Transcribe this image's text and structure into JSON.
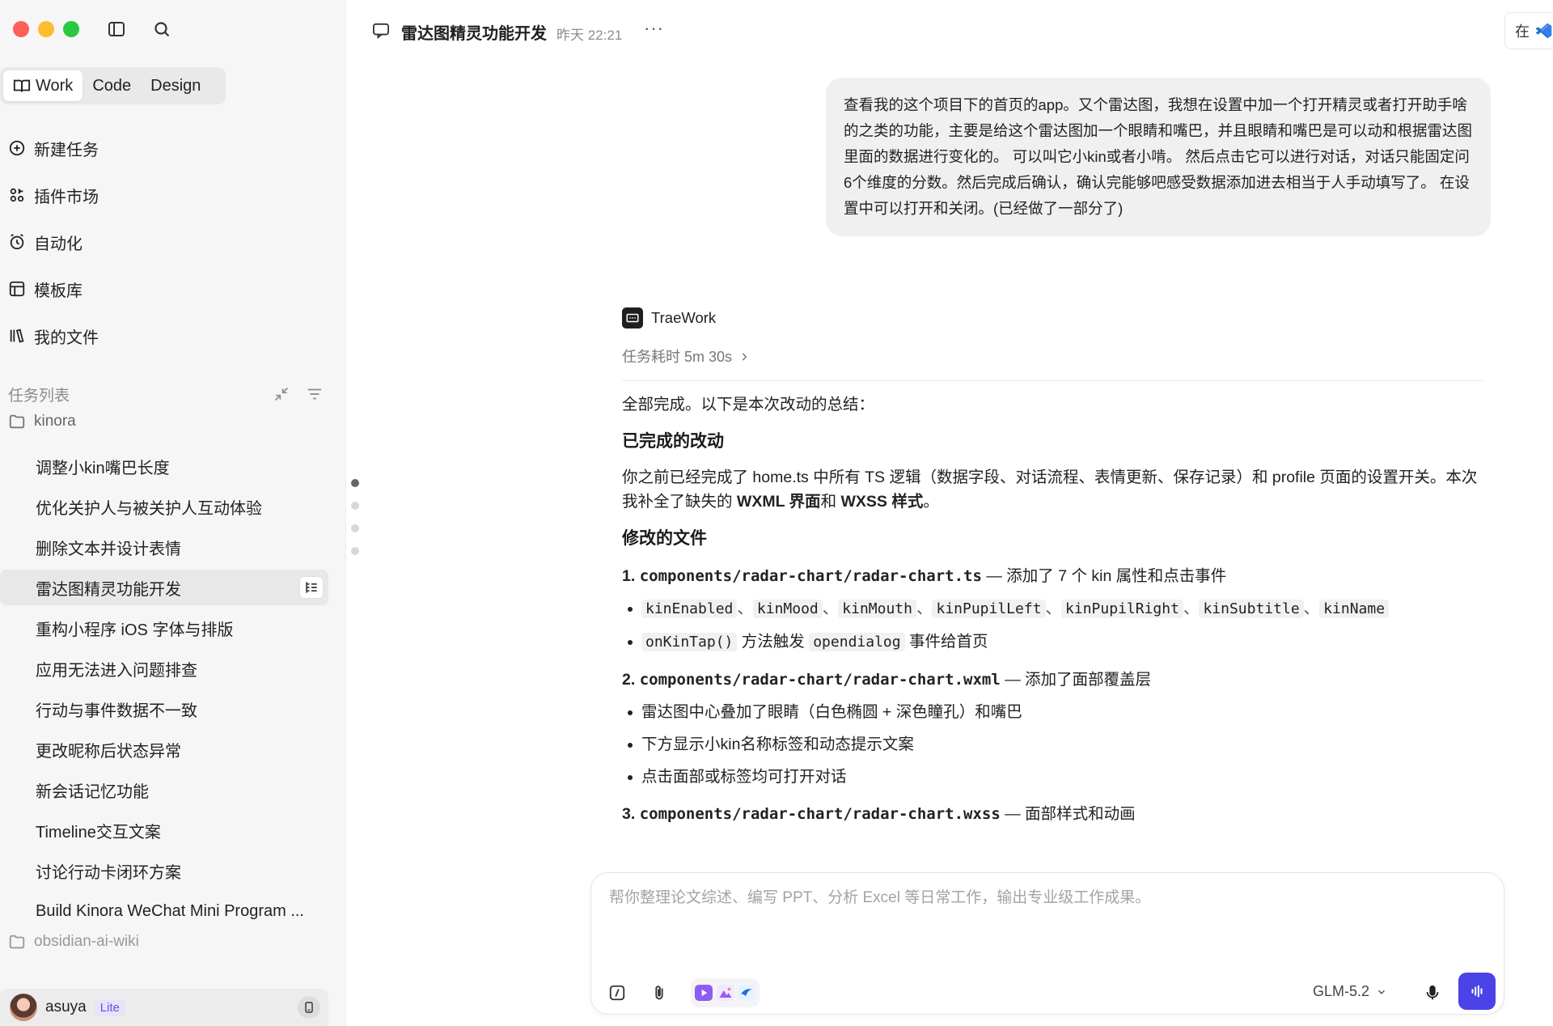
{
  "sidebar": {
    "modes": [
      {
        "label": "Work",
        "active": true
      },
      {
        "label": "Code",
        "active": false
      },
      {
        "label": "Design",
        "active": false
      }
    ],
    "nav": [
      {
        "label": "新建任务",
        "icon": "plus-circle-icon"
      },
      {
        "label": "插件市场",
        "icon": "plugins-icon"
      },
      {
        "label": "自动化",
        "icon": "alarm-clock-icon"
      },
      {
        "label": "模板库",
        "icon": "template-icon"
      },
      {
        "label": "我的文件",
        "icon": "library-icon"
      }
    ],
    "section_title": "任务列表",
    "folders": [
      "kinora",
      "obsidian-ai-wiki"
    ],
    "tasks": [
      "调整小kin嘴巴长度",
      "优化关护人与被关护人互动体验",
      "删除文本并设计表情",
      "雷达图精灵功能开发",
      "重构小程序 iOS 字体与排版",
      "应用无法进入问题排查",
      "行动与事件数据不一致",
      "更改昵称后状态异常",
      "新会话记忆功能",
      "Timeline交互文案",
      "讨论行动卡闭环方案",
      "Build Kinora WeChat Mini Program ..."
    ],
    "active_task_index": 3,
    "user": {
      "name": "asuya",
      "plan": "Lite"
    }
  },
  "header": {
    "title": "雷达图精灵功能开发",
    "time": "昨天 22:21",
    "more": "···",
    "right_chip": "在"
  },
  "user_message": "查看我的这个项目下的首页的app。又个雷达图，我想在设置中加一个打开精灵或者打开助手啥的之类的功能，主要是给这个雷达图加一个眼睛和嘴巴，并且眼睛和嘴巴是可以动和根据雷达图里面的数据进行变化的。 可以叫它小kin或者小啃。 然后点击它可以进行对话，对话只能固定问6个维度的分数。然后完成后确认，确认完能够吧感受数据添加进去相当于人手动填写了。 在设置中可以打开和关闭。(已经做了一部分了)",
  "reply": {
    "agent": "TraeWork",
    "duration": "任务耗时 5m 30s",
    "intro": "全部完成。以下是本次改动的总结：",
    "h_done": "已完成的改动",
    "done_part1": "你之前已经完成了 home.ts 中所有 TS 逻辑（数据字段、对话流程、表情更新、保存记录）和 profile 页面的设置开关。本次我补全了缺失的 ",
    "done_bold": "WXML 界面",
    "done_mid": "和 ",
    "done_bold2": "WXSS 样式",
    "done_end": "。",
    "h_files": "修改的文件",
    "file1": {
      "idx": "1.",
      "path": "components/radar-chart/radar-chart.ts",
      "desc": " — 添加了 7 个 kin 属性和点击事件",
      "props": [
        "kinEnabled",
        "kinMood",
        "kinMouth",
        "kinPupilLeft",
        "kinPupilRight",
        "kinSubtitle",
        "kinName"
      ],
      "sep": "、",
      "b2_code1": "onKinTap()",
      "b2_text1": " 方法触发 ",
      "b2_code2": "opendialog",
      "b2_text2": " 事件给首页"
    },
    "file2": {
      "idx": "2.",
      "path": "components/radar-chart/radar-chart.wxml",
      "desc": " — 添加了面部覆盖层",
      "bullets": [
        "雷达图中心叠加了眼睛（白色椭圆 + 深色瞳孔）和嘴巴",
        "下方显示小kin名称标签和动态提示文案",
        "点击面部或标签均可打开对话"
      ]
    },
    "file3": {
      "idx": "3.",
      "path": "components/radar-chart/radar-chart.wxss",
      "desc": " — 面部样式和动画"
    }
  },
  "composer": {
    "placeholder": "帮你整理论文综述、编写 PPT、分析 Excel 等日常工作，输出专业级工作成果。",
    "model": "GLM-5.2"
  },
  "colors": {
    "accent": "#4a43e8",
    "sidebar_bg": "#f6f6f6",
    "bubble_bg": "#f0f0f0"
  }
}
